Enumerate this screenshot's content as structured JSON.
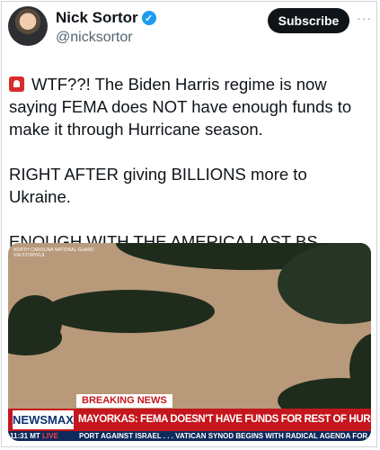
{
  "author": {
    "name": "Nick Sortor",
    "handle": "@nicksortor",
    "verified": true
  },
  "subscribe_label": "Subscribe",
  "more_label": "···",
  "tweet": {
    "line1": "WTF??! The Biden Harris regime is now saying FEMA does NOT have enough funds to make it through Hurricane season.",
    "line2": "RIGHT AFTER giving BILLIONS more to Ukraine.",
    "line3": "ENOUGH WITH THE AMERICA LAST BS."
  },
  "media": {
    "credit_line1": "NORTH CAROLINA NATIONAL GUARD",
    "credit_line2": "VIA STORYFUL",
    "breaking": "BREAKING NEWS",
    "logo": "NEWSMAX",
    "headline": "MAYORKAS: FEMA DOESN'T HAVE FUNDS FOR REST OF HURRICANE SEASON",
    "time": "11:31 MT",
    "live": "LIVE",
    "ticker": "PORT AGAINST ISRAEL . . .   VATICAN SYNOD BEGINS WITH RADICAL AGENDA FOR CHI"
  },
  "colors": {
    "verified": "#1d9bf0",
    "newsmax_red": "#c5161d",
    "newsmax_blue": "#0e3272"
  }
}
